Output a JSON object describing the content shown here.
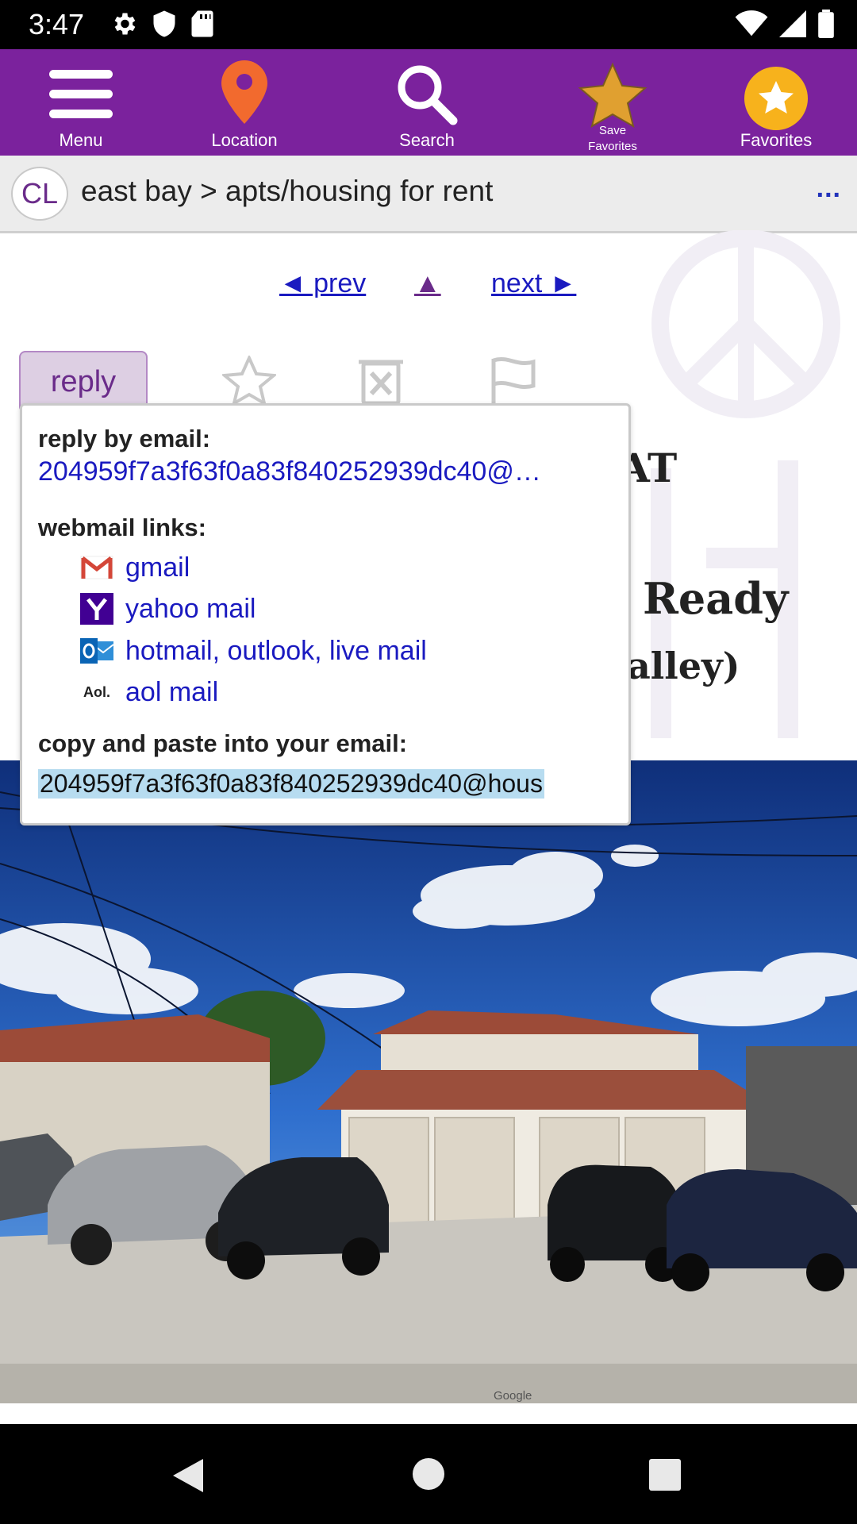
{
  "status_bar": {
    "time": "3:47",
    "left_icons": [
      "gear-icon",
      "shield-icon",
      "sd-card-icon"
    ],
    "right_icons": [
      "wifi-icon",
      "cell-signal-icon",
      "battery-icon"
    ]
  },
  "toolbar": {
    "menu_label": "Menu",
    "location_label": "Location",
    "search_label": "Search",
    "save_favorites_label_line1": "Save",
    "save_favorites_label_line2": "Favorites",
    "favorites_label": "Favorites",
    "background_color": "#7b229d",
    "location_pin_color": "#f26a2e",
    "star_color": "#e0a030"
  },
  "breadcrumb": {
    "badge": "CL",
    "path": "east bay > apts/housing for rent",
    "more": "..."
  },
  "post_nav": {
    "prev": "◄ prev",
    "up": "▲",
    "next": "next ►"
  },
  "actions": {
    "reply": "reply",
    "icons": [
      "star-icon",
      "trash-icon",
      "flag-icon"
    ]
  },
  "title_fragments": {
    "line1_tail": "AT",
    "line2_tail": "Ready",
    "line3_tail": "alley)"
  },
  "reply_popup": {
    "reply_by_email_heading": "reply by email:",
    "reply_email_truncated": "204959f7a3f63f0a83f840252939dc40@…",
    "webmail_heading": "webmail links:",
    "webmail_links": [
      {
        "label": "gmail",
        "icon": "gmail-icon"
      },
      {
        "label": "yahoo mail",
        "icon": "yahoo-icon"
      },
      {
        "label": "hotmail, outlook, live mail",
        "icon": "outlook-icon"
      },
      {
        "label": "aol mail",
        "icon": "aol-icon"
      }
    ],
    "aol_logo_text": "Aol.",
    "copy_heading": "copy and paste into your email:",
    "copy_value": "204959f7a3f63f0a83f840252939dc40@hous"
  },
  "photo": {
    "watermark": "Google"
  },
  "system_nav": {
    "icons": [
      "back-icon",
      "home-icon",
      "recents-icon"
    ]
  }
}
